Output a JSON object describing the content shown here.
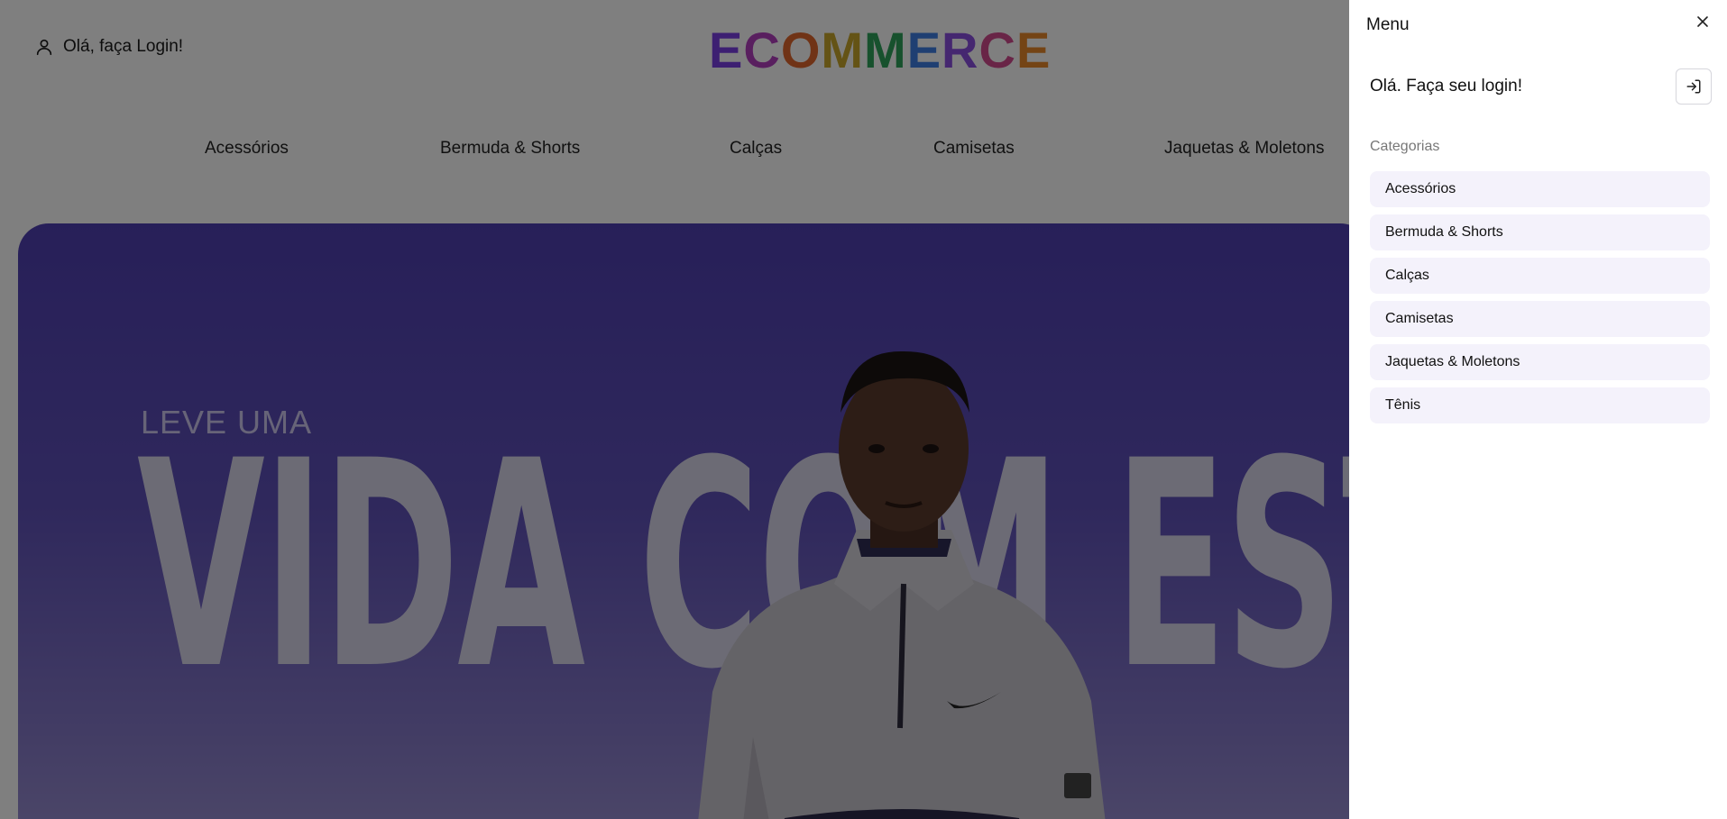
{
  "header": {
    "login_text": "Olá, faça Login!",
    "logo_letters": [
      {
        "char": "E",
        "color": "#7b3fe4"
      },
      {
        "char": "C",
        "color": "#b23fbf"
      },
      {
        "char": "O",
        "color": "#e0672d"
      },
      {
        "char": "M",
        "color": "#c8a62b"
      },
      {
        "char": "M",
        "color": "#2fa35a"
      },
      {
        "char": "E",
        "color": "#3f7ee4"
      },
      {
        "char": "R",
        "color": "#8a4fe0"
      },
      {
        "char": "C",
        "color": "#d24a8f"
      },
      {
        "char": "E",
        "color": "#e8892b"
      }
    ]
  },
  "nav": {
    "items": [
      "Acessórios",
      "Bermuda & Shorts",
      "Calças",
      "Camisetas",
      "Jaquetas & Moletons"
    ]
  },
  "hero": {
    "kicker": "LEVE UMA",
    "title": "VIDA COM ESTI"
  },
  "drawer": {
    "title": "Menu",
    "greeting": "Olá. Faça seu login!",
    "categories_label": "Categorias",
    "categories": [
      "Acessórios",
      "Bermuda & Shorts",
      "Calças",
      "Camisetas",
      "Jaquetas & Moletons",
      "Tênis"
    ]
  },
  "colors": {
    "hero_gradient_top": "#4f3fb2",
    "overlay": "rgba(0,0,0,0.5)",
    "category_bg": "#f4f2fb"
  }
}
